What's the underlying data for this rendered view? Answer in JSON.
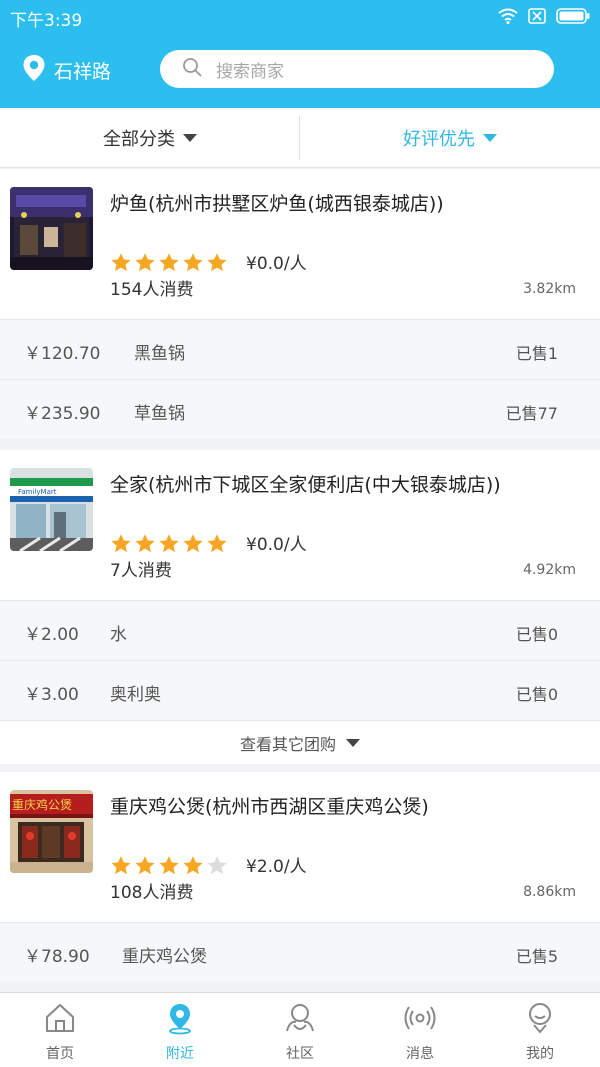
{
  "status_bar": {
    "time": "下午3:39"
  },
  "header": {
    "location": "石祥路",
    "search_placeholder": "搜索商家"
  },
  "filters": {
    "category": "全部分类",
    "sort": "好评优先"
  },
  "merchants": [
    {
      "name": "炉鱼(杭州市拱墅区炉鱼(城西银泰城店))",
      "rating": 5,
      "per_capita": "¥0.0/人",
      "consume_count": "154人消费",
      "distance": "3.82km",
      "deals": [
        {
          "price": "￥120.70",
          "name": "黑鱼锅",
          "sold": "已售1"
        },
        {
          "price": "￥235.90",
          "name": "草鱼锅",
          "sold": "已售77"
        }
      ]
    },
    {
      "name": "全家(杭州市下城区全家便利店(中大银泰城店))",
      "rating": 5,
      "per_capita": "¥0.0/人",
      "consume_count": "7人消费",
      "distance": "4.92km",
      "deals": [
        {
          "price": "￥2.00",
          "name": "水",
          "sold": "已售0"
        },
        {
          "price": "￥3.00",
          "name": "奥利奥",
          "sold": "已售0"
        }
      ],
      "more_label": "查看其它团购"
    },
    {
      "name": "重庆鸡公煲(杭州市西湖区重庆鸡公煲)",
      "rating": 4,
      "per_capita": "¥2.0/人",
      "consume_count": "108人消费",
      "distance": "8.86km",
      "deals": [
        {
          "price": "￥78.90",
          "name": "重庆鸡公煲",
          "sold": "已售5"
        }
      ]
    }
  ],
  "thumb_text": {
    "familymart": "FamilyMart",
    "chicken_sign": "重庆鸡公煲"
  },
  "bottom_nav": [
    {
      "label": "首页",
      "icon": "home-icon",
      "active": false
    },
    {
      "label": "附近",
      "icon": "location-pin-icon",
      "active": true
    },
    {
      "label": "社区",
      "icon": "community-icon",
      "active": false
    },
    {
      "label": "消息",
      "icon": "broadcast-icon",
      "active": false
    },
    {
      "label": "我的",
      "icon": "profile-icon",
      "active": false
    }
  ],
  "colors": {
    "brand": "#2dbef0",
    "accent_text": "#2fb7e6",
    "star": "#f6a623",
    "star_empty": "#dcdcdc"
  }
}
